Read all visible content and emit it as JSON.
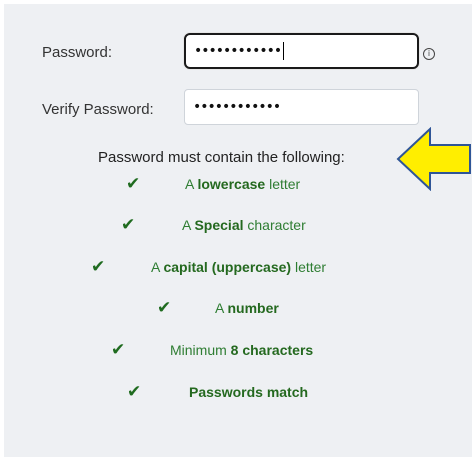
{
  "form": {
    "password_label": "Password:",
    "password_value": "••••••••••••",
    "verify_label": "Verify Password:",
    "verify_value": "••••••••••••",
    "info_icon": "i"
  },
  "requirements": {
    "header": "Password must contain the following:",
    "items": [
      {
        "pre": "A ",
        "bold": "lowercase",
        "post": " letter",
        "met": true
      },
      {
        "pre": "A ",
        "bold": "Special",
        "post": " character",
        "met": true
      },
      {
        "pre": "A ",
        "bold": "capital (uppercase)",
        "post": " letter",
        "met": true
      },
      {
        "pre": "A ",
        "bold": "number",
        "post": "",
        "met": true
      },
      {
        "pre": "Minimum ",
        "bold": "8 characters",
        "post": "",
        "met": true
      },
      {
        "pre": "",
        "bold": "Passwords match",
        "post": "",
        "met": true
      }
    ]
  },
  "colors": {
    "panel_bg": "#eef0f3",
    "check_green": "#1f6b1f",
    "arrow_fill": "#ffee00",
    "arrow_stroke": "#2f5597"
  },
  "icons": {
    "check": "checkmark-icon",
    "info": "info-icon",
    "arrow": "left-arrow-icon"
  }
}
